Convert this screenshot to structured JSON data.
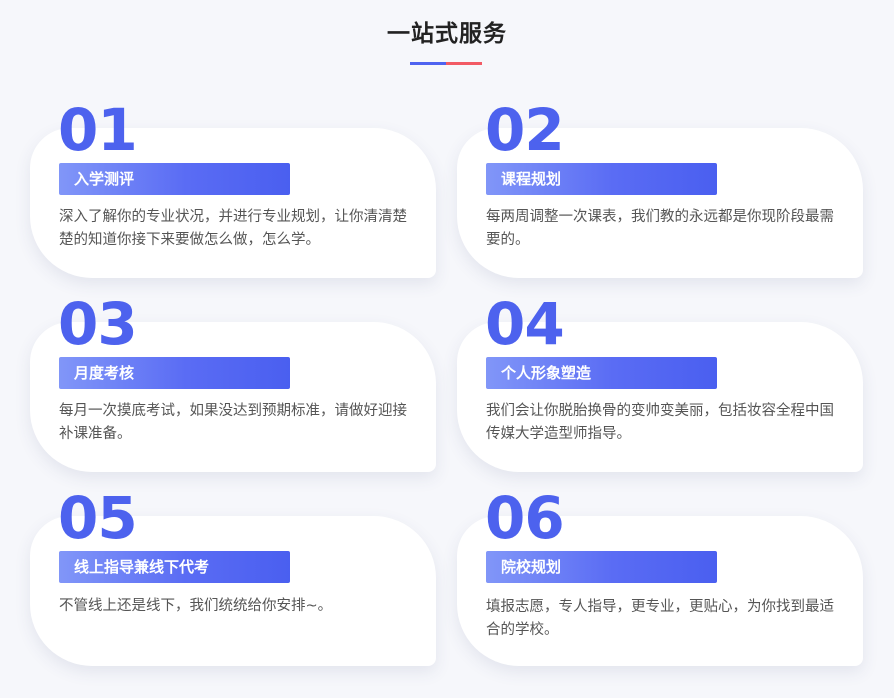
{
  "header": {
    "title": "一站式服务",
    "accent_colors": [
      "#4f63f0",
      "#f25a64"
    ]
  },
  "theme": {
    "number_color": "#4d62ee",
    "tag_gradient": [
      "#8196f8",
      "#4a5ff0"
    ]
  },
  "cards": [
    {
      "number": "01",
      "tag": "入学测评",
      "desc": "深入了解你的专业状况，并进行专业规划，让你清清楚楚的知道你接下来要做怎么做，怎么学。"
    },
    {
      "number": "02",
      "tag": "课程规划",
      "desc": "每两周调整一次课表，我们教的永远都是你现阶段最需要的。"
    },
    {
      "number": "03",
      "tag": "月度考核",
      "desc": "每月一次摸底考试，如果没达到预期标准，请做好迎接补课准备。"
    },
    {
      "number": "04",
      "tag": "个人形象塑造",
      "desc": "我们会让你脱胎换骨的变帅变美丽，包括妆容全程中国传媒大学造型师指导。"
    },
    {
      "number": "05",
      "tag": "线上指导兼线下代考",
      "desc": "不管线上还是线下，我们统统给你安排~。"
    },
    {
      "number": "06",
      "tag": "院校规划",
      "desc": "填报志愿，专人指导，更专业，更贴心，为你找到最适合的学校。"
    }
  ]
}
